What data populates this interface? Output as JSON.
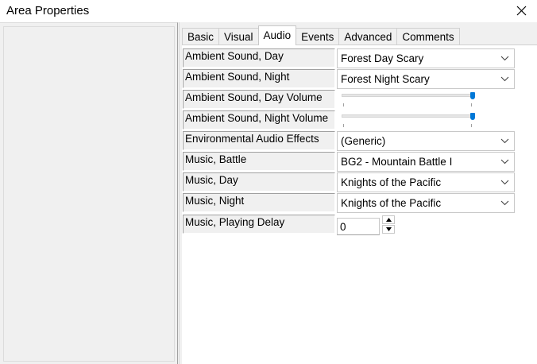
{
  "window": {
    "title": "Area Properties"
  },
  "tabs": [
    {
      "label": "Basic"
    },
    {
      "label": "Visual"
    },
    {
      "label": "Audio"
    },
    {
      "label": "Events"
    },
    {
      "label": "Advanced"
    },
    {
      "label": "Comments"
    }
  ],
  "active_tab": "Audio",
  "properties": {
    "ambient_day": {
      "label": "Ambient Sound, Day",
      "value": "Forest Day Scary"
    },
    "ambient_night": {
      "label": "Ambient Sound, Night",
      "value": "Forest Night Scary"
    },
    "ambient_day_volume": {
      "label": "Ambient Sound, Day Volume",
      "level": 1.0
    },
    "ambient_night_volume": {
      "label": "Ambient Sound, Night Volume",
      "level": 1.0
    },
    "env_audio": {
      "label": "Environmental Audio Effects",
      "value": "(Generic)"
    },
    "music_battle": {
      "label": "Music, Battle",
      "value": "BG2 - Mountain Battle I"
    },
    "music_day": {
      "label": "Music, Day",
      "value": "Knights of the Pacific"
    },
    "music_night": {
      "label": "Music, Night",
      "value": "Knights of the Pacific"
    },
    "music_delay": {
      "label": "Music, Playing Delay",
      "value": "0"
    }
  },
  "colors": {
    "accent": "#0078d7"
  }
}
